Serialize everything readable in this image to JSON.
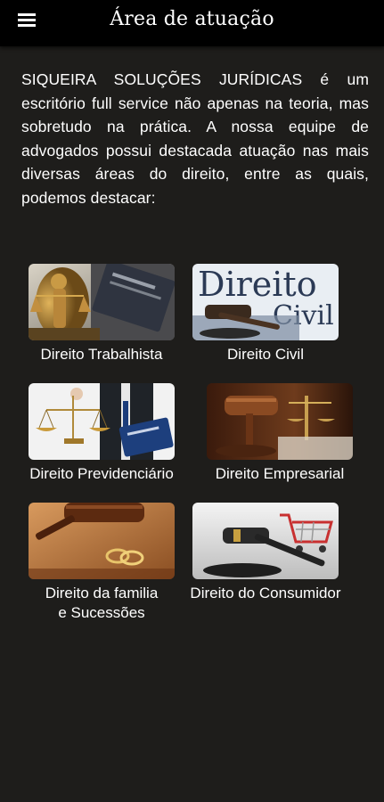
{
  "header": {
    "title": "Área de atuação",
    "menu_icon": "hamburger-menu-icon"
  },
  "intro": {
    "text": "SIQUEIRA SOLUÇÕES JURÍDICAS é um escritório full service não apenas na teoria, mas sobretudo na prática. A nossa equipe de advogados possui destacada atuação nas mais diversas áreas do direito, entre as quais, podemos destacar:"
  },
  "areas": [
    {
      "label": "Direito Trabalhista",
      "image": "lady-justice-work-card-image"
    },
    {
      "label": "Direito Civil",
      "image": "direito-civil-gavel-image",
      "image_text_1": "Direito",
      "image_text_2": "Civil"
    },
    {
      "label": "Direito Previdenciário",
      "image": "scales-pension-card-image"
    },
    {
      "label": "Direito Empresarial",
      "image": "gavel-and-scales-image"
    },
    {
      "label_line1": "Direito da familia",
      "label_line2": "e Sucessões",
      "image": "gavel-wedding-rings-image"
    },
    {
      "label": "Direito do Consumidor",
      "image": "gavel-shopping-cart-image"
    }
  ],
  "colors": {
    "background": "#1e1d1b",
    "appbar": "#000000",
    "text": "#ffffff"
  }
}
